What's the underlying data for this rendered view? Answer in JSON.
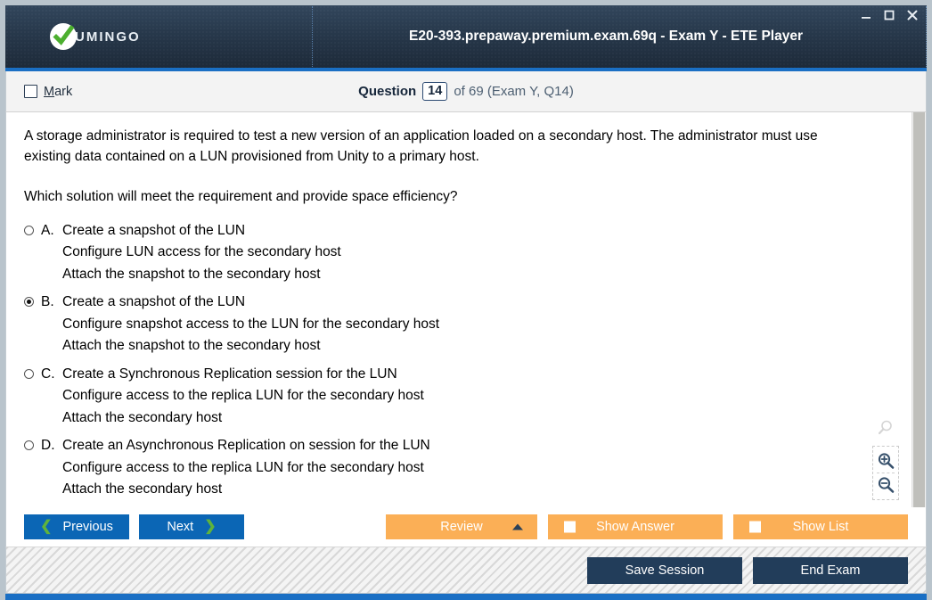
{
  "window": {
    "logo_text": "UMINGO",
    "logo_icon": "check-circle-icon",
    "title": "E20-393.prepaway.premium.exam.69q - Exam Y - ETE Player",
    "minimize_label": "minimize-icon",
    "maximize_label": "maximize-icon",
    "close_label": "close-icon"
  },
  "qheader": {
    "mark_label_pre": "M",
    "mark_label_post": "ark",
    "question_word": "Question",
    "question_number": "14",
    "question_tail": "of 69 (Exam Y, Q14)"
  },
  "question": {
    "paragraph1": "A storage administrator is required to test a new version of an application loaded on a secondary host. The administrator must use existing data contained on a LUN provisioned from Unity to a primary host.",
    "paragraph2": "Which solution will meet the requirement and provide space efficiency?",
    "options": [
      {
        "letter": "A.",
        "selected": false,
        "line1": "Create a snapshot of the LUN",
        "line2": "Configure LUN access for the secondary host",
        "line3": "Attach the snapshot to the secondary host"
      },
      {
        "letter": "B.",
        "selected": true,
        "line1": "Create a snapshot of the LUN",
        "line2": "Configure snapshot access to the LUN for the secondary host",
        "line3": "Attach the snapshot to the secondary host"
      },
      {
        "letter": "C.",
        "selected": false,
        "line1": "Create a Synchronous Replication session for the LUN",
        "line2": "Configure access to the replica LUN for the secondary host",
        "line3": "Attach the secondary host"
      },
      {
        "letter": "D.",
        "selected": false,
        "line1": "Create an Asynchronous Replication on session for the LUN",
        "line2": "Configure access to the replica LUN for the secondary host",
        "line3": "Attach the secondary host"
      }
    ]
  },
  "zoomtools": {
    "ghost": "magnifier-icon",
    "zoom_in": "zoom-in-icon",
    "zoom_out": "zoom-out-icon"
  },
  "actions": {
    "previous": "Previous",
    "next": "Next",
    "review": "Review",
    "show_answer": "Show Answer",
    "show_list": "Show List"
  },
  "footer": {
    "save_session": "Save Session",
    "end_exam": "End Exam"
  },
  "colors": {
    "accent_blue": "#1a6fc4",
    "nav_blue": "#0b66b5",
    "orange": "#fbaf56",
    "dark_navy": "#223d5a",
    "green": "#5fb33d"
  }
}
